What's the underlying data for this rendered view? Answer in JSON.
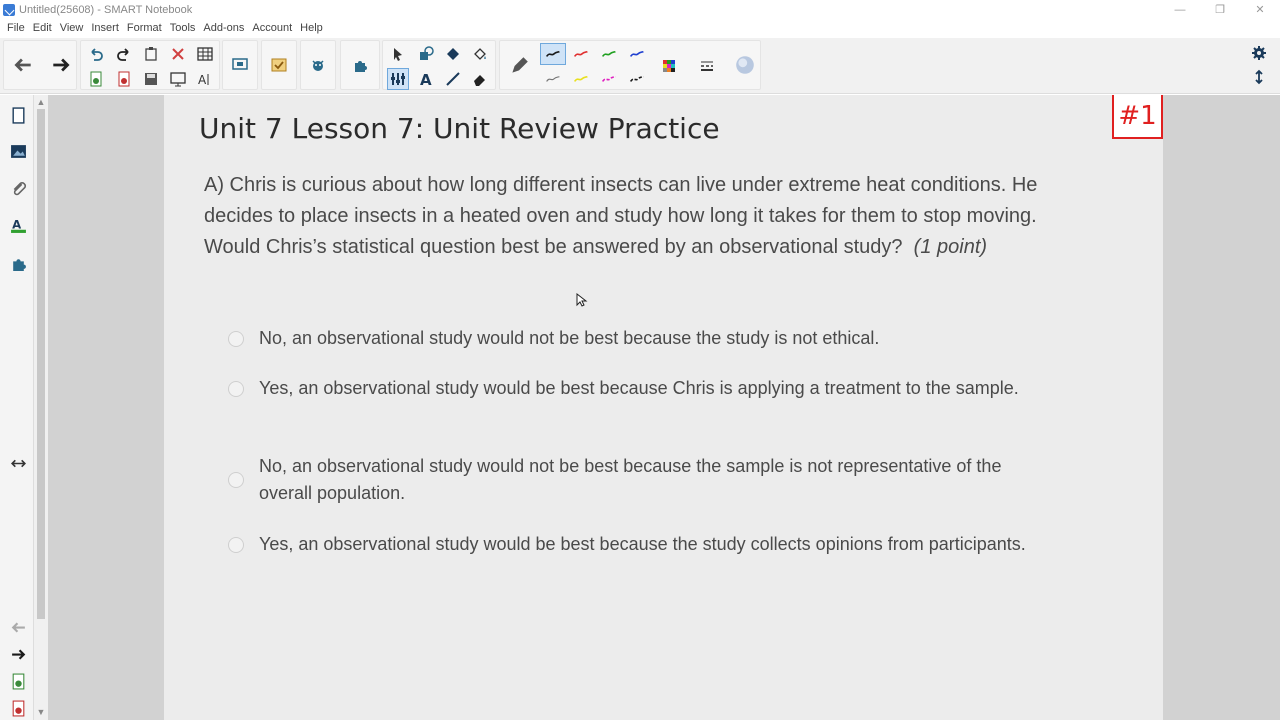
{
  "window": {
    "title": "Untitled(25608) - SMART Notebook",
    "controls": [
      "minimize",
      "restore",
      "close"
    ]
  },
  "menubar": {
    "items": [
      "File",
      "Edit",
      "View",
      "Insert",
      "Format",
      "Tools",
      "Add-ons",
      "Account",
      "Help"
    ]
  },
  "toolbar": {
    "icons": [
      "back-arrow-icon",
      "forward-arrow-icon",
      "undo-icon",
      "redo-icon",
      "paste-icon",
      "delete-icon",
      "table-icon",
      "add-page-icon",
      "delete-page-icon",
      "save-icon",
      "screen-shade-icon",
      "text-recognize-icon",
      "display-icon",
      "response-icon",
      "addons-icon",
      "select-icon",
      "shapes-icon",
      "fill-icon",
      "eraser-icon",
      "pen-icon",
      "text-icon",
      "line-icon",
      "color-palette-icon",
      "line-style-icon",
      "fill-effects-icon",
      "settings-gear-icon",
      "expand-icon"
    ],
    "pen_colors": [
      "#1a1a1a",
      "#e03030",
      "#20a020",
      "#2040d0",
      "#777777",
      "#e8e020",
      "#e020c0",
      "#1a1a1a"
    ]
  },
  "sidebar": {
    "tabs": [
      "page-sorter-icon",
      "gallery-icon",
      "attachments-icon",
      "properties-icon",
      "addons-icon"
    ]
  },
  "page": {
    "title": "Unit 7 Lesson 7: Unit Review Practice",
    "badge": "#1",
    "question": {
      "text": "A) Chris is curious about how long different insects can live under extreme heat conditions. He decides to place insects in a heated oven and study how long it takes for them to stop moving. Would Chris’s statistical question best be answered by an observational study?",
      "points": "(1 point)"
    },
    "options": [
      "No, an observational study would not be best because the study is not ethical.",
      "Yes, an observational study would be best because Chris is applying a treatment to the sample.",
      "No, an observational study would not be best because the sample is not representative of the overall population.",
      "Yes, an observational study would be best because the study collects opinions from participants."
    ]
  },
  "colors": {
    "badge_red": "#e02020",
    "page_bg": "#ececec",
    "workspace_bg": "#d2d2d2"
  }
}
